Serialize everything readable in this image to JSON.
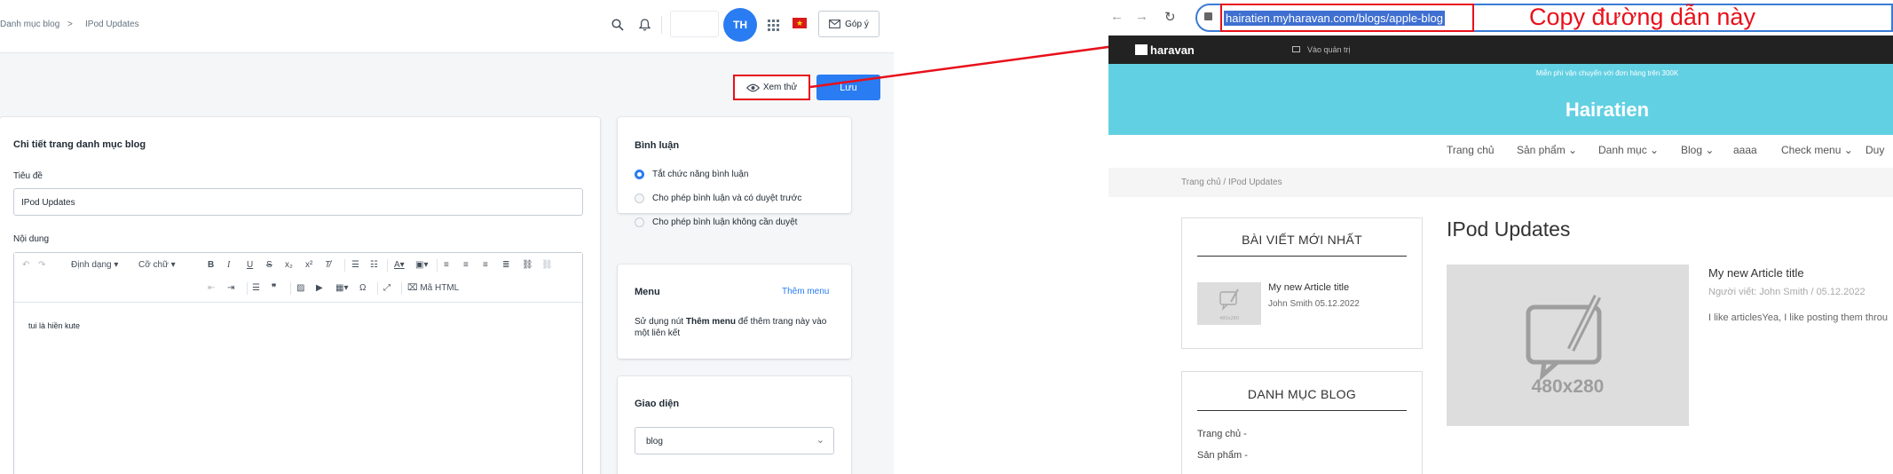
{
  "admin": {
    "breadcrumb": {
      "parent": "Danh mục blog",
      "separator": ">",
      "current": "IPod Updates"
    },
    "header": {
      "avatar_initials": "TH",
      "feedback_label": "Góp ý"
    },
    "actions": {
      "preview_label": "Xem thử",
      "save_label": "Lưu"
    },
    "main": {
      "heading": "Chi tiết trang danh mục blog",
      "title_label": "Tiêu đề",
      "title_value": "IPod Updates",
      "content_label": "Nội dung",
      "toolbar": {
        "format": "Định dạng",
        "font_size": "Cỡ chữ",
        "html": "Mã HTML",
        "omega": "Ω"
      },
      "content_text": "tui là hiền kute"
    },
    "comments": {
      "heading": "Bình luận",
      "options": [
        "Tắt chức năng bình luận",
        "Cho phép bình luận và có duyệt trước",
        "Cho phép bình luận không cần duyệt"
      ]
    },
    "menu": {
      "heading": "Menu",
      "add_link": "Thêm menu",
      "desc_pre": "Sử dụng nút ",
      "desc_bold": "Thêm menu",
      "desc_post": " để thêm trang này vào một liên kết"
    },
    "theme": {
      "heading": "Giao diện",
      "selected": "blog"
    }
  },
  "browser": {
    "url": "hairatien.myharavan.com/blogs/apple-blog",
    "annotation": "Copy đường dẫn này",
    "site": {
      "logo": "haravan",
      "admin_link": "Vào quản trị",
      "promo": "Miễn phí vận chuyển với đơn hàng trên 300K",
      "name": "Hairatien",
      "menu": [
        "Trang chủ",
        "Sản phẩm",
        "Danh mục",
        "Blog",
        "aaaa",
        "Check menu",
        "Duy"
      ],
      "crumb": "Trang chủ  /  IPod Updates",
      "latest_heading": "BÀI VIẾT MỚI NHẤT",
      "latest_title": "My new Article title",
      "latest_meta": "John Smith 05.12.2022",
      "cat_heading": "DANH MỤC BLOG",
      "cats": [
        "Trang chủ",
        "Sản phẩm"
      ],
      "page_title": "IPod Updates",
      "thumb_label": "480x280",
      "article_title": "My new Article title",
      "article_meta": "Người viết: John Smith / 05.12.2022",
      "article_excerpt": "I like articlesYea, I like posting them throu"
    }
  }
}
